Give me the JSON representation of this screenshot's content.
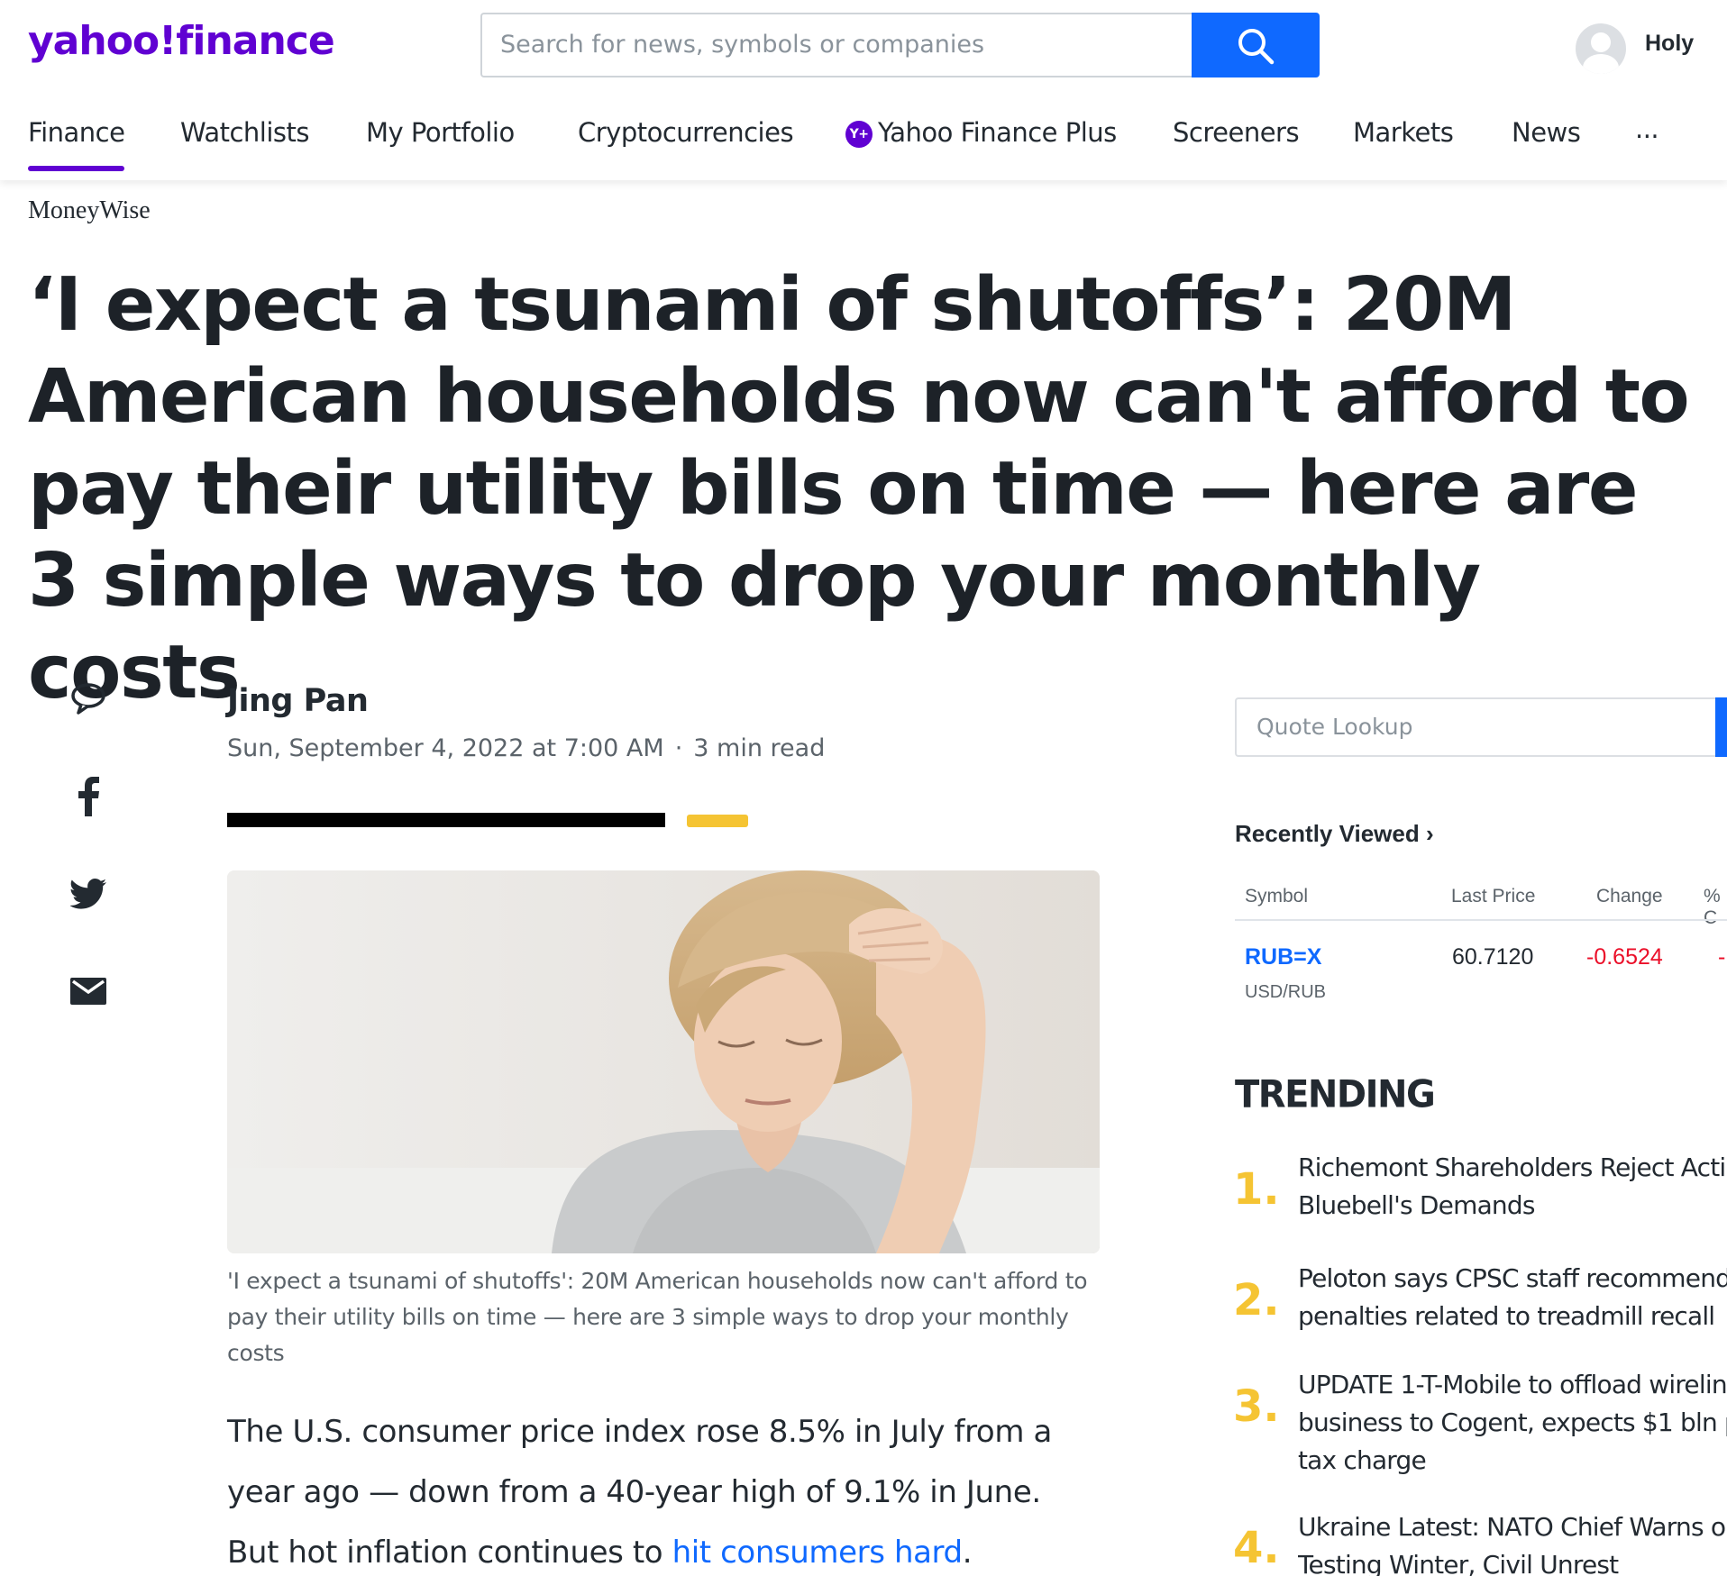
{
  "header": {
    "logo_yahoo": "yahoo!",
    "logo_finance": "finance",
    "search_placeholder": "Search for news, symbols or companies",
    "user_name": "Holy"
  },
  "nav": {
    "items": [
      {
        "label": "Finance"
      },
      {
        "label": "Watchlists"
      },
      {
        "label": "My Portfolio"
      },
      {
        "label": "Cryptocurrencies"
      },
      {
        "label": "Yahoo Finance Plus"
      },
      {
        "label": "Screeners"
      },
      {
        "label": "Markets"
      },
      {
        "label": "News"
      },
      {
        "label": "..."
      }
    ],
    "plus_badge": "Y+"
  },
  "article": {
    "source": "MoneyWise",
    "headline": "‘I expect a tsunami of shutoffs’: 20M American households now can't afford to pay their utility bills on time — here are 3 simple ways to drop your monthly costs",
    "author": "Jing Pan",
    "date": "Sun, September 4, 2022 at 7:00 AM",
    "read_time": "3 min read",
    "caption": "'I expect a tsunami of shutoffs': 20M American households now can't afford to pay their utility bills on time — here are 3 simple ways to drop your monthly costs",
    "body_text": "The U.S. consumer price index rose 8.5% in July from a year ago — down from a 40-year high of 9.1% in June. But hot inflation continues to ",
    "body_link": "hit consumers hard",
    "body_end": "."
  },
  "share": {
    "icons": [
      "comment-icon",
      "facebook-icon",
      "twitter-icon",
      "email-icon"
    ]
  },
  "sidebar": {
    "quote_placeholder": "Quote Lookup",
    "recently_viewed_title": "Recently Viewed",
    "columns": {
      "symbol": "Symbol",
      "last_price": "Last Price",
      "change": "Change",
      "pct": "% C"
    },
    "rows": [
      {
        "symbol": "RUB=X",
        "name": "USD/RUB",
        "last_price": "60.7120",
        "change": "-0.6524",
        "pct": "-"
      }
    ],
    "trending_title": "TRENDING",
    "trending": [
      {
        "num": "1.",
        "line1": "Richemont Shareholders Reject Acti",
        "line2": "Bluebell's Demands"
      },
      {
        "num": "2.",
        "line1": "Peloton says CPSC staff recommend",
        "line2": "penalties related to treadmill recall"
      },
      {
        "num": "3.",
        "line1": "UPDATE 1-T-Mobile to offload wirelin",
        "line2": "business to Cogent, expects $1 bln p",
        "line3": "tax charge"
      },
      {
        "num": "4.",
        "line1": "Ukraine Latest: NATO Chief Warns o",
        "line2": "Testing Winter, Civil Unrest"
      }
    ]
  },
  "colors": {
    "brand": "#6001d2",
    "accent_blue": "#0f69ff",
    "trending_yellow": "#f5c433",
    "negative": "#eb0f29"
  }
}
